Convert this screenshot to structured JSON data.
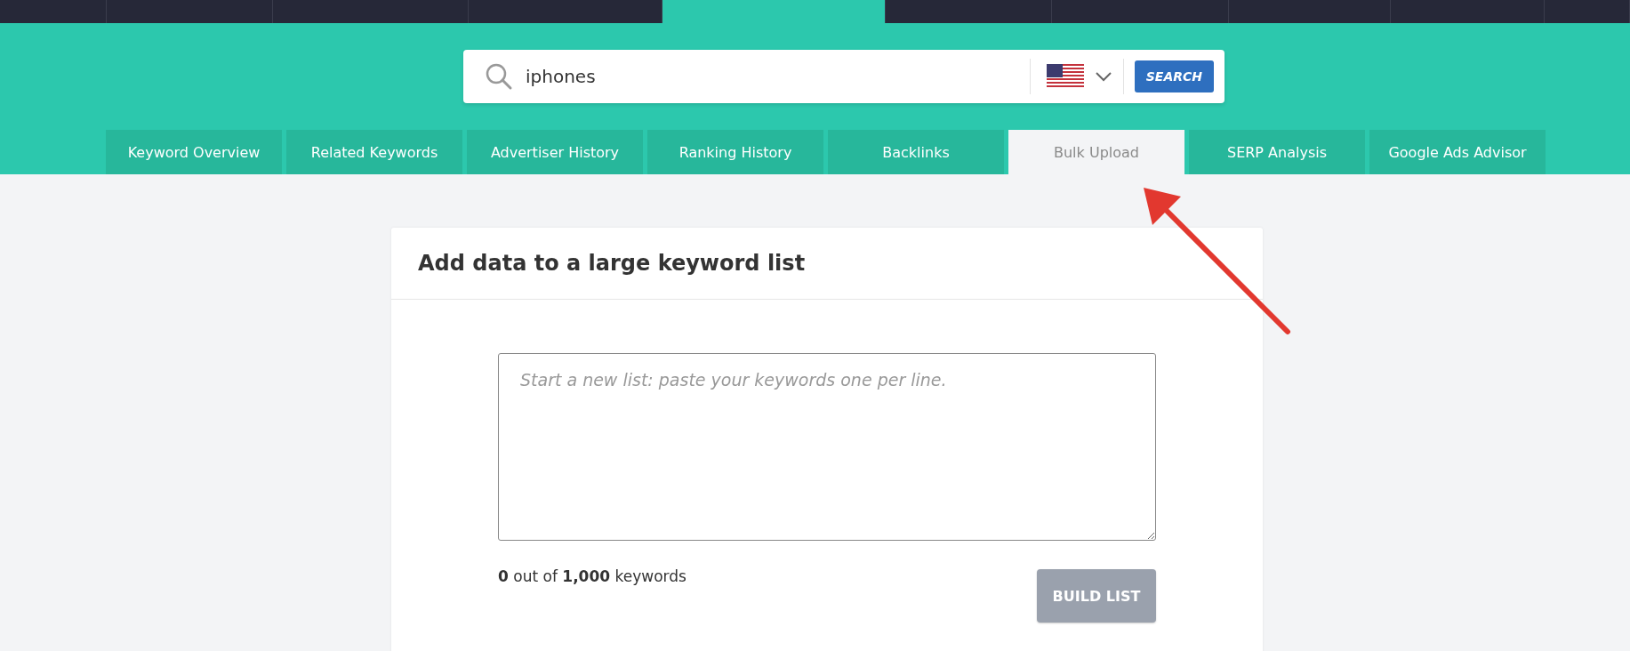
{
  "top_nav": {
    "items": [
      {
        "selected": false
      },
      {
        "selected": false
      },
      {
        "selected": false
      },
      {
        "selected": false
      },
      {
        "selected": true
      },
      {
        "selected": false
      },
      {
        "selected": false
      },
      {
        "selected": false
      },
      {
        "selected": false
      },
      {
        "selected": false
      }
    ]
  },
  "search": {
    "value": "iphones",
    "button": "SEARCH"
  },
  "tabs": [
    {
      "label": "Keyword Overview",
      "selected": false
    },
    {
      "label": "Related Keywords",
      "selected": false
    },
    {
      "label": "Advertiser History",
      "selected": false
    },
    {
      "label": "Ranking History",
      "selected": false
    },
    {
      "label": "Backlinks",
      "selected": false
    },
    {
      "label": "Bulk Upload",
      "selected": true
    },
    {
      "label": "SERP Analysis",
      "selected": false
    },
    {
      "label": "Google Ads Advisor",
      "selected": false
    }
  ],
  "card": {
    "title": "Add data to a large keyword list",
    "textarea": {
      "placeholder": "Start a new list: paste your keywords one per line."
    },
    "counter": "**0** out of **1,000** keywords",
    "button": {
      "label": "BUILD LIST",
      "disabled": true
    }
  },
  "annotation": {
    "kind": "arrow"
  }
}
